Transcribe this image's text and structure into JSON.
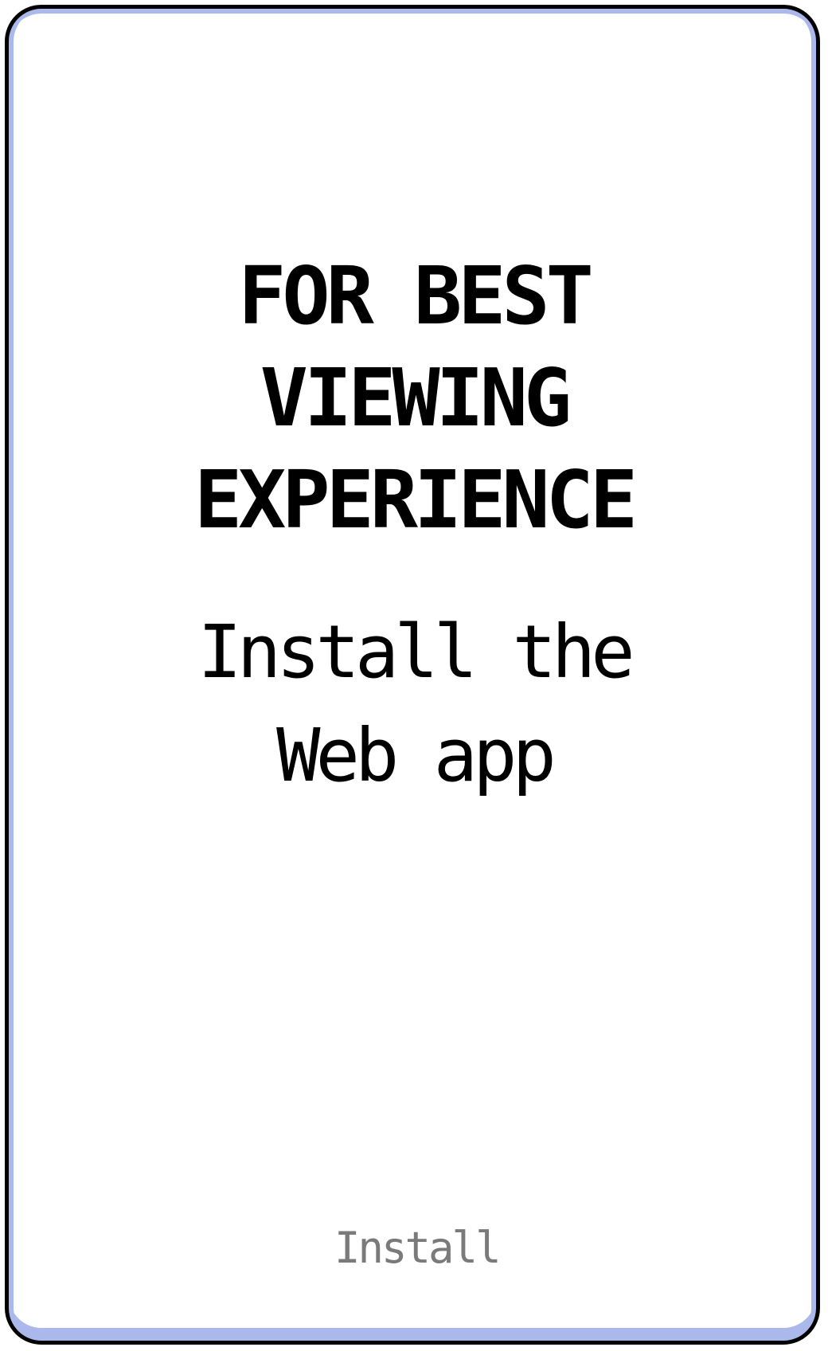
{
  "prompt": {
    "headline_lines": [
      "FOR BEST",
      "VIEWING",
      "EXPERIENCE"
    ],
    "subline_lines": [
      "Install the",
      "Web app"
    ]
  },
  "actions": {
    "install_label": "Install"
  },
  "colors": {
    "frame_border": "#000000",
    "frame_inner_shade": "#aab8ec",
    "text_primary": "#000000",
    "button_text": "#7a7a7a"
  }
}
